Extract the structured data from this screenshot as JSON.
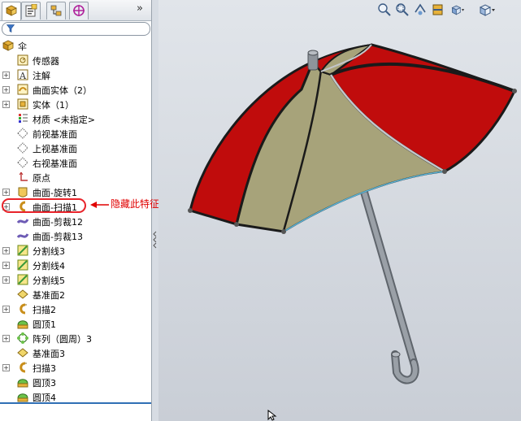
{
  "tabs": [
    {
      "name": "feature-manager"
    },
    {
      "name": "property-manager"
    },
    {
      "name": "configuration-manager"
    },
    {
      "name": "dim-xpert"
    }
  ],
  "tab_more_glyph": "»",
  "tree": {
    "root_label": "伞",
    "items": [
      {
        "label": "传感器",
        "icon": "sensor-icon",
        "expand": false,
        "indent": 2
      },
      {
        "label": "注解",
        "icon": "annotation-icon",
        "expand": true,
        "indent": 2
      },
      {
        "label": "曲面实体（2）",
        "icon": "surface-bodies-icon",
        "expand": true,
        "indent": 2
      },
      {
        "label": "实体（1）",
        "icon": "solid-bodies-icon",
        "expand": true,
        "indent": 2
      },
      {
        "label": "材质 <未指定>",
        "icon": "material-icon",
        "expand": false,
        "indent": 2
      },
      {
        "label": "前视基准面",
        "icon": "plane-icon",
        "expand": false,
        "indent": 2
      },
      {
        "label": "上视基准面",
        "icon": "plane-icon",
        "expand": false,
        "indent": 2
      },
      {
        "label": "右视基准面",
        "icon": "plane-icon",
        "expand": false,
        "indent": 2
      },
      {
        "label": "原点",
        "icon": "origin-icon",
        "expand": false,
        "indent": 2
      },
      {
        "label": "曲面-旋转1",
        "icon": "surface-revolve-icon",
        "expand": true,
        "indent": 2
      },
      {
        "label": "曲面-扫描1",
        "icon": "surface-sweep-icon",
        "expand": true,
        "indent": 2
      },
      {
        "label": "曲面-剪裁12",
        "icon": "surface-trim-icon",
        "expand": false,
        "indent": 2
      },
      {
        "label": "曲面-剪裁13",
        "icon": "surface-trim-icon",
        "expand": false,
        "indent": 2
      },
      {
        "label": "分割线3",
        "icon": "split-line-icon",
        "expand": true,
        "indent": 2
      },
      {
        "label": "分割线4",
        "icon": "split-line-icon",
        "expand": true,
        "indent": 2
      },
      {
        "label": "分割线5",
        "icon": "split-line-icon",
        "expand": true,
        "indent": 2
      },
      {
        "label": "基准面2",
        "icon": "ref-plane-icon",
        "expand": false,
        "indent": 2
      },
      {
        "label": "扫描2",
        "icon": "sweep-icon",
        "expand": true,
        "indent": 2
      },
      {
        "label": "圆顶1",
        "icon": "dome-icon",
        "expand": false,
        "indent": 2
      },
      {
        "label": "阵列（圆周）3",
        "icon": "circular-pattern-icon",
        "expand": true,
        "indent": 2
      },
      {
        "label": "基准面3",
        "icon": "ref-plane-icon",
        "expand": false,
        "indent": 2
      },
      {
        "label": "扫描3",
        "icon": "sweep-icon",
        "expand": true,
        "indent": 2
      },
      {
        "label": "圆顶3",
        "icon": "dome-icon",
        "expand": false,
        "indent": 2
      },
      {
        "label": "圆顶4",
        "icon": "dome-icon",
        "expand": false,
        "indent": 2
      }
    ]
  },
  "annotation": {
    "text": "隐藏此特征",
    "color": "#e00000"
  },
  "view_toolbar": [
    {
      "name": "zoom-to-fit-icon"
    },
    {
      "name": "zoom-to-area-icon"
    },
    {
      "name": "previous-view-icon"
    },
    {
      "name": "section-view-icon"
    },
    {
      "name": "view-orientation-icon"
    },
    {
      "name": "display-style-icon"
    }
  ],
  "colors": {
    "canopy_red": "#c00c0c",
    "canopy_khaki": "#a7a37a",
    "shaft": "#8f959c",
    "viewport_bg": "#d7dce3",
    "highlight": "#e8232a"
  }
}
